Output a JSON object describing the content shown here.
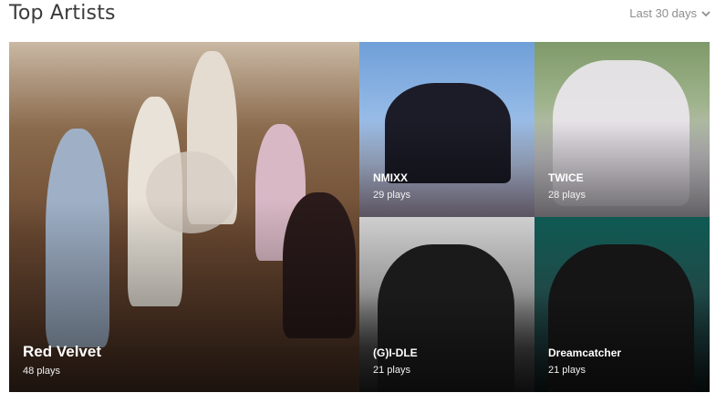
{
  "header": {
    "title": "Top Artists",
    "range_label": "Last 30 days",
    "range_icon": "chevron-down-icon"
  },
  "artists": [
    {
      "name": "Red Velvet",
      "plays": "48 plays"
    },
    {
      "name": "NMIXX",
      "plays": "29 plays"
    },
    {
      "name": "TWICE",
      "plays": "28 plays"
    },
    {
      "name": "(G)I-DLE",
      "plays": "21 plays"
    },
    {
      "name": "Dreamcatcher",
      "plays": "21 plays"
    }
  ],
  "colors": {
    "title": "#3a3a3a",
    "muted": "#8e8e8e"
  }
}
